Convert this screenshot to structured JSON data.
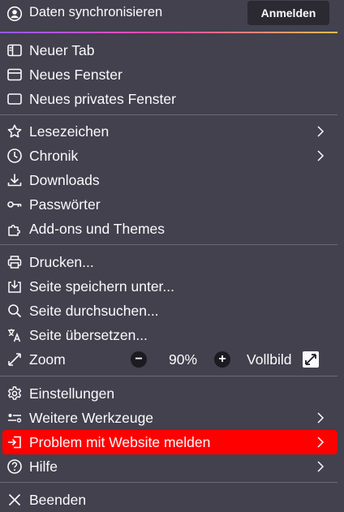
{
  "account": {
    "sync_label": "Daten synchronisieren",
    "signin_label": "Anmelden"
  },
  "group1": [
    {
      "label": "Neuer Tab",
      "icon": "new-tab-icon"
    },
    {
      "label": "Neues Fenster",
      "icon": "new-window-icon"
    },
    {
      "label": "Neues privates Fenster",
      "icon": "private-window-icon"
    }
  ],
  "group2": [
    {
      "label": "Lesezeichen",
      "icon": "star-icon",
      "submenu": true
    },
    {
      "label": "Chronik",
      "icon": "clock-icon",
      "submenu": true
    },
    {
      "label": "Downloads",
      "icon": "download-icon"
    },
    {
      "label": "Passwörter",
      "icon": "key-icon"
    },
    {
      "label": "Add-ons und Themes",
      "icon": "puzzle-icon"
    }
  ],
  "group3": [
    {
      "label": "Drucken...",
      "icon": "printer-icon"
    },
    {
      "label": "Seite speichern unter...",
      "icon": "save-icon"
    },
    {
      "label": "Seite durchsuchen...",
      "icon": "search-icon"
    },
    {
      "label": "Seite übersetzen...",
      "icon": "translate-icon"
    }
  ],
  "zoom": {
    "label": "Zoom",
    "decrease": "−",
    "value": "90%",
    "increase": "+",
    "fullscreen_label": "Vollbild"
  },
  "group4": [
    {
      "label": "Einstellungen",
      "icon": "gear-icon"
    },
    {
      "label": "Weitere Werkzeuge",
      "icon": "tools-icon",
      "submenu": true
    },
    {
      "label": "Problem mit Website melden",
      "icon": "report-icon",
      "submenu": true,
      "highlighted": true
    },
    {
      "label": "Hilfe",
      "icon": "help-icon",
      "submenu": true
    }
  ],
  "quit": {
    "label": "Beenden",
    "icon": "close-icon"
  },
  "colors": {
    "background": "#42414d",
    "text": "#fbfbfe",
    "highlight": "#ff0000",
    "separator": "#6a6975",
    "button_bg": "#2b2a33"
  }
}
